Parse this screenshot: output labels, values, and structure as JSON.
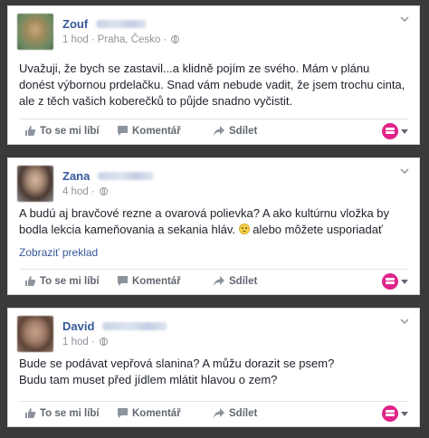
{
  "posts": [
    {
      "author": "Zouf",
      "time": "1 hod",
      "location": "Praha, Česko",
      "lines": [
        "Uvažuji, že bych se zastavil...a klidně pojím ze svého. Mám v plánu",
        "donést výbornou prdelačku. Snad vám nebude vadit, že jsem trochu cinta,",
        "ale z těch vašich koberečků to půjde snadno vyčistit."
      ]
    },
    {
      "author": "Zana",
      "time": "4 hod",
      "lines": [
        "A budú aj bravčové rezne a ovarová polievka? A ako kultúrnu vložka by",
        "bodla lekcia kameňovania a sekania hláv."
      ],
      "line_tail": "alebo môžete usporiadať",
      "translate": "Zobraziť preklad"
    },
    {
      "author": "David",
      "time": "1 hod",
      "lines": [
        "Bude se podávat vepřová slanina? A můžu dorazit se psem?",
        "Budu tam muset před jídlem mlátit hlavou o zem?"
      ]
    }
  ],
  "actions": {
    "like": "To se mi líbí",
    "comment": "Komentář",
    "share": "Sdílet"
  },
  "icons": {
    "audience": "globe-icon",
    "menu": "chevron-down-icon",
    "like": "thumbs-up-icon",
    "comment": "comment-icon",
    "share": "share-arrow-icon",
    "reaction": "reaction-picker-icon",
    "emoji": "smiley-emoji-icon"
  },
  "colors": {
    "link": "#365899",
    "text": "#1d2129",
    "meta": "#90949c",
    "action": "#616770",
    "reaction": "#e0248a",
    "page_background": "#3a3a3a"
  }
}
